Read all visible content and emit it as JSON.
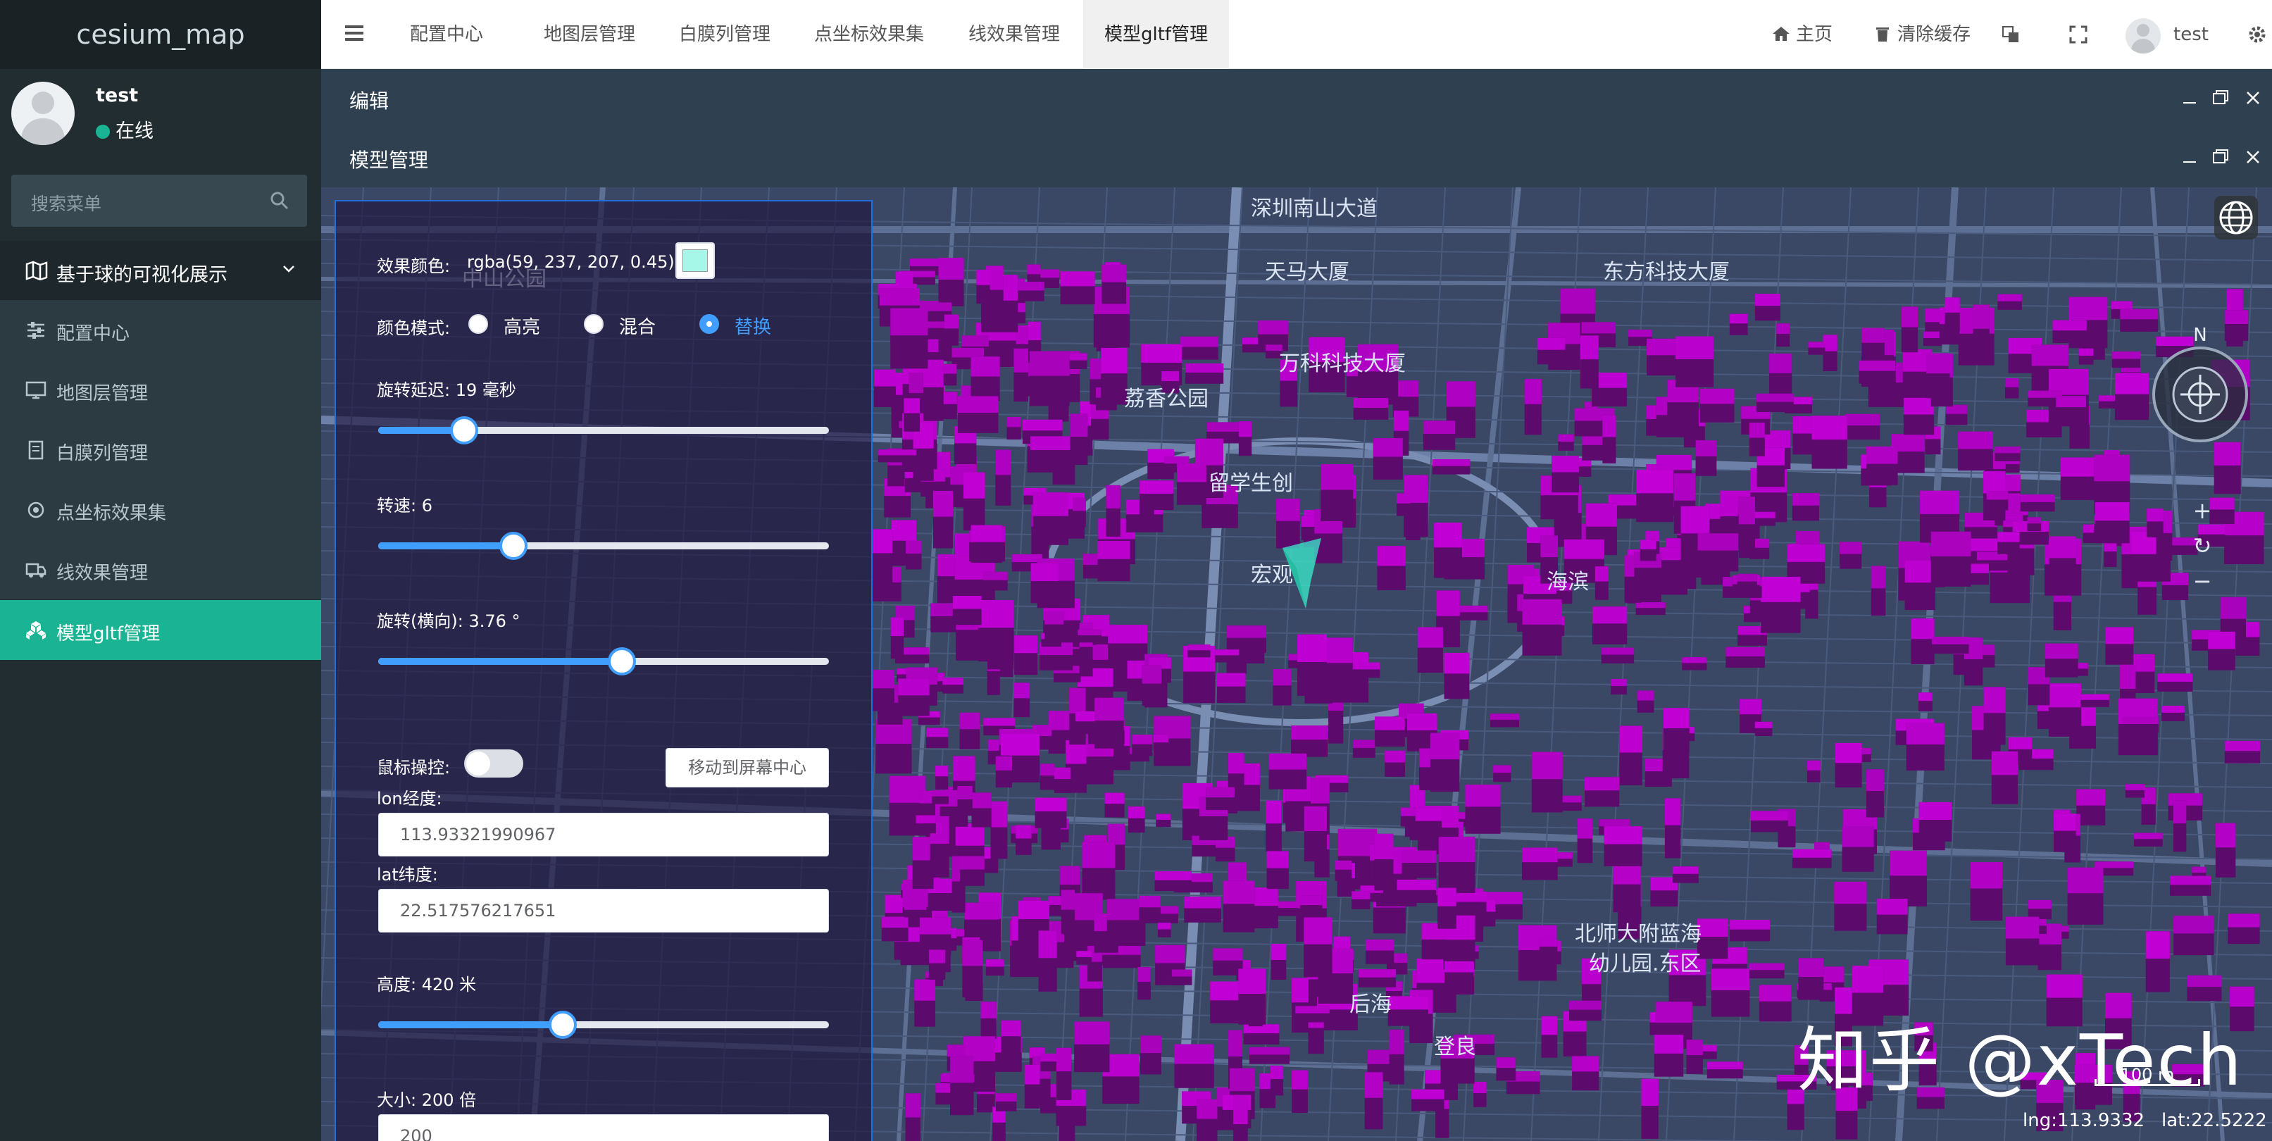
{
  "app": {
    "title": "cesium_map"
  },
  "user": {
    "name": "test",
    "status": "在线"
  },
  "sidebar": {
    "search_placeholder": "搜索菜单",
    "group_label": "基于球的可视化展示",
    "items": [
      {
        "label": "配置中心",
        "icon": "sliders-icon"
      },
      {
        "label": "地图层管理",
        "icon": "map-layer-icon"
      },
      {
        "label": "白膜列管理",
        "icon": "document-icon"
      },
      {
        "label": "点坐标效果集",
        "icon": "target-icon"
      },
      {
        "label": "线效果管理",
        "icon": "truck-icon"
      },
      {
        "label": "模型gltf管理",
        "icon": "cubes-icon",
        "active": true
      }
    ]
  },
  "topnav": {
    "tabs": [
      "配置中心",
      "地图层管理",
      "白膜列管理",
      "点坐标效果集",
      "线效果管理",
      "模型gltf管理"
    ],
    "active_tab": "模型gltf管理",
    "home": "主页",
    "clear_cache": "清除缓存",
    "username": "test"
  },
  "windows": {
    "edit_title": "编辑",
    "model_title": "模型管理"
  },
  "panel": {
    "color_label": "效果颜色:",
    "color_value": "rgba(59, 237, 207, 0.45)",
    "mode_label": "颜色模式:",
    "modes": [
      "高亮",
      "混合",
      "替换"
    ],
    "mode_selected": "替换",
    "rotate_delay_label": "旋转延迟: 19 毫秒",
    "rotate_delay_value": 19,
    "rotate_delay_max": 100,
    "speed_label": "转速: 6",
    "speed_value": 6,
    "speed_max": 20,
    "heading_label": "旋转(横向): 3.76 °",
    "heading_fraction": 0.54,
    "mouse_control_label": "鼠标操控:",
    "mouse_control_on": false,
    "move_center_button": "移动到屏幕中心",
    "lon_label": "lon经度:",
    "lon_value": "113.93321990967",
    "lat_label": "lat纬度:",
    "lat_value": "22.517576217651",
    "height_label": "高度: 420 米",
    "height_fraction": 0.41,
    "size_label": "大小: 200 倍",
    "size_value": "200"
  },
  "map": {
    "compass_n": "N",
    "watermark": "知乎 @xTech",
    "scale": "100 m",
    "lng": "lng:113.9332",
    "lat": "lat:22.5222",
    "place_labels": [
      "深圳南山大道",
      "天马大厦",
      "中山公园",
      "东方科技大厦",
      "万科科技大厦",
      "荔香公园",
      "留学生创",
      "宏观",
      "海滨",
      "北师大附蓝海",
      "幼儿园.东区",
      "后海",
      "登良"
    ],
    "building_color": "#c200d6",
    "model_color": "#3bedcf"
  }
}
